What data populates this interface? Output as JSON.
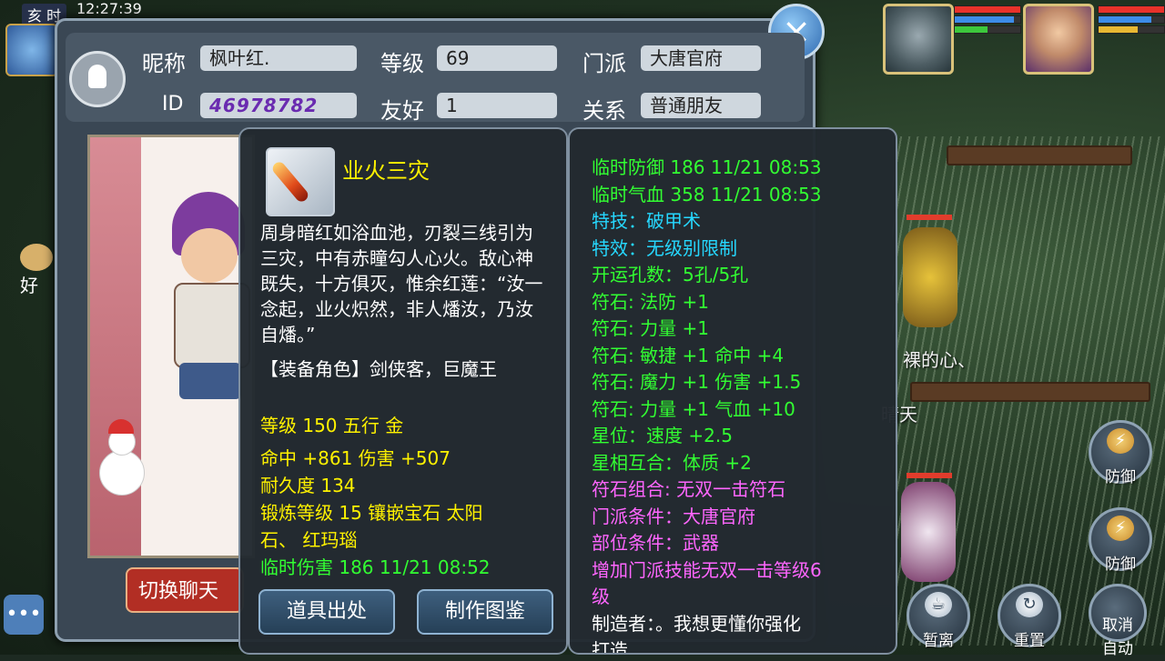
{
  "status": {
    "hour": "亥 时",
    "time": "12:27:39"
  },
  "world": {
    "text1": "裸的心、",
    "text2": "晴天"
  },
  "side": {
    "friend_label": "好",
    "chat_icon": "speech-bubble"
  },
  "actions": {
    "defend1": "防御",
    "defend2": "防御",
    "away": "暂离",
    "repeat": "重置",
    "cancel_auto": "取消\n自动"
  },
  "friend_info": {
    "nickname_label": "昵称",
    "nickname": "枫叶红.",
    "level_label": "等级",
    "level": "69",
    "school_label": "门派",
    "school": "大唐官府",
    "id_label": "ID",
    "id": "46978782",
    "friendliness_label": "友好",
    "friendliness": "1",
    "relation_label": "关系",
    "relation": "普通朋友",
    "switch_chat": "切换聊天",
    "close": "×"
  },
  "item": {
    "name": "业火三灾",
    "description": "周身暗红如浴血池，刃裂三线引为三灾，中有赤瞳勾人心火。敌心神既失，十方俱灭，惟余红莲：“汝一念起，业火炽然，非人燔汝，乃汝自燔。”",
    "roles": "【装备角色】剑侠客，巨魔王",
    "level_line": "等级 150  五行 金",
    "hit_line": "命中 +861 伤害 +507",
    "durability": "耐久度 134",
    "forge_line1": "锻炼等级 15  镶嵌宝石 太阳",
    "forge_line2": "石、 红玛瑙",
    "temp_damage": "临时伤害 186 11/21 08:52",
    "source_button": "道具出处",
    "craft_button": "制作图鉴"
  },
  "attributes": [
    {
      "text": "临时防御 186 11/21 08:53",
      "color": "g"
    },
    {
      "text": "临时气血 358 11/21 08:53",
      "color": "g"
    },
    {
      "text": "特技：破甲术",
      "color": "c"
    },
    {
      "text": "特效：无级别限制",
      "color": "c"
    },
    {
      "text": "开运孔数：5孔/5孔",
      "color": "g"
    },
    {
      "text": "符石: 法防 +1",
      "color": "g"
    },
    {
      "text": "符石: 力量 +1",
      "color": "g"
    },
    {
      "text": "符石: 敏捷 +1 命中 +4",
      "color": "g"
    },
    {
      "text": "符石: 魔力 +1 伤害 +1.5",
      "color": "g"
    },
    {
      "text": "符石: 力量 +1 气血 +10",
      "color": "g"
    },
    {
      "text": "星位：速度 +2.5",
      "color": "g"
    },
    {
      "text": "星相互合：体质 +2",
      "color": "g"
    },
    {
      "text": "符石组合: 无双一击符石",
      "color": "p"
    },
    {
      "text": "门派条件：大唐官府",
      "color": "p"
    },
    {
      "text": "部位条件：武器",
      "color": "p"
    },
    {
      "text": "增加门派技能无双一击等级6",
      "color": "p"
    },
    {
      "text": "级",
      "color": "p"
    },
    {
      "text": "制造者：。我想更懂你强化",
      "color": "w"
    },
    {
      "text": "打造",
      "color": "w"
    }
  ],
  "bars": {
    "pet": [
      1.0,
      0.9,
      0.5
    ],
    "hero": [
      1.0,
      0.8,
      0.6
    ]
  },
  "colors": {
    "hp": "#e8322a",
    "mp": "#3c8ce8",
    "sp": "#e8b832",
    "exp": "#3cc83c"
  }
}
